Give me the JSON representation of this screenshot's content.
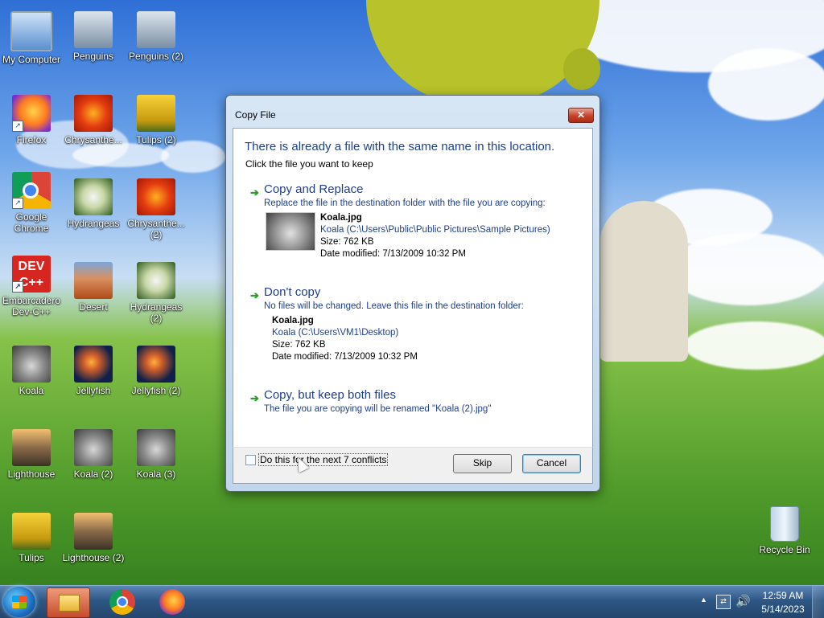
{
  "desktop": {
    "icons": [
      {
        "label": "My Computer",
        "icon": "computer-icon"
      },
      {
        "label": "Penguins",
        "icon": "image-icon"
      },
      {
        "label": "Penguins (2)",
        "icon": "image-icon"
      },
      {
        "label": "Firefox",
        "icon": "firefox-icon"
      },
      {
        "label": "Chrysanthe...",
        "icon": "image-icon"
      },
      {
        "label": "Tulips (2)",
        "icon": "image-icon"
      },
      {
        "label": "Google Chrome",
        "icon": "chrome-icon"
      },
      {
        "label": "Hydrangeas",
        "icon": "image-icon"
      },
      {
        "label": "Chrysanthe... (2)",
        "icon": "image-icon"
      },
      {
        "label": "Embarcadero Dev-C++",
        "icon": "devcpp-icon",
        "glyph": "DEV C++"
      },
      {
        "label": "Desert",
        "icon": "image-icon"
      },
      {
        "label": "Hydrangeas (2)",
        "icon": "image-icon"
      },
      {
        "label": "Koala",
        "icon": "image-icon"
      },
      {
        "label": "Jellyfish",
        "icon": "image-icon"
      },
      {
        "label": "Jellyfish (2)",
        "icon": "image-icon"
      },
      {
        "label": "Lighthouse",
        "icon": "image-icon"
      },
      {
        "label": "Koala (2)",
        "icon": "image-icon"
      },
      {
        "label": "Koala (3)",
        "icon": "image-icon"
      },
      {
        "label": "Tulips",
        "icon": "image-icon"
      },
      {
        "label": "Lighthouse (2)",
        "icon": "image-icon"
      }
    ],
    "recycle_bin": {
      "label": "Recycle Bin",
      "icon": "recycle-bin-icon"
    }
  },
  "dialog": {
    "title": "Copy File",
    "close_glyph": "✕",
    "headline": "There is already a file with the same name in this location.",
    "subhead": "Click the file you want to keep",
    "options": [
      {
        "title": "Copy and Replace",
        "desc": "Replace the file in the destination folder with the file you are copying:",
        "file": {
          "name": "Koala.jpg",
          "path": "Koala (C:\\Users\\Public\\Public Pictures\\Sample Pictures)",
          "size": "Size: 762 KB",
          "modified": "Date modified: 7/13/2009 10:32 PM"
        }
      },
      {
        "title": "Don't copy",
        "desc": "No files will be changed. Leave this file in the destination folder:",
        "file": {
          "name": "Koala.jpg",
          "path": "Koala (C:\\Users\\VM1\\Desktop)",
          "size": "Size: 762 KB",
          "modified": "Date modified: 7/13/2009 10:32 PM"
        }
      },
      {
        "title": "Copy, but keep both files",
        "desc": "The file you are copying will be renamed \"Koala (2).jpg\""
      }
    ],
    "checkbox_label": "Do this for the next 7 conflicts",
    "checkbox_checked": false,
    "skip_label": "Skip",
    "cancel_label": "Cancel"
  },
  "taskbar": {
    "start_icon": "windows-start-icon",
    "pinned": [
      "file-explorer-icon",
      "chrome-icon",
      "firefox-icon"
    ],
    "tray": {
      "up_arrow": "▲",
      "network_glyph": "⇄",
      "volume_glyph": "🔊",
      "time": "12:59 AM",
      "date": "5/14/2023"
    }
  }
}
